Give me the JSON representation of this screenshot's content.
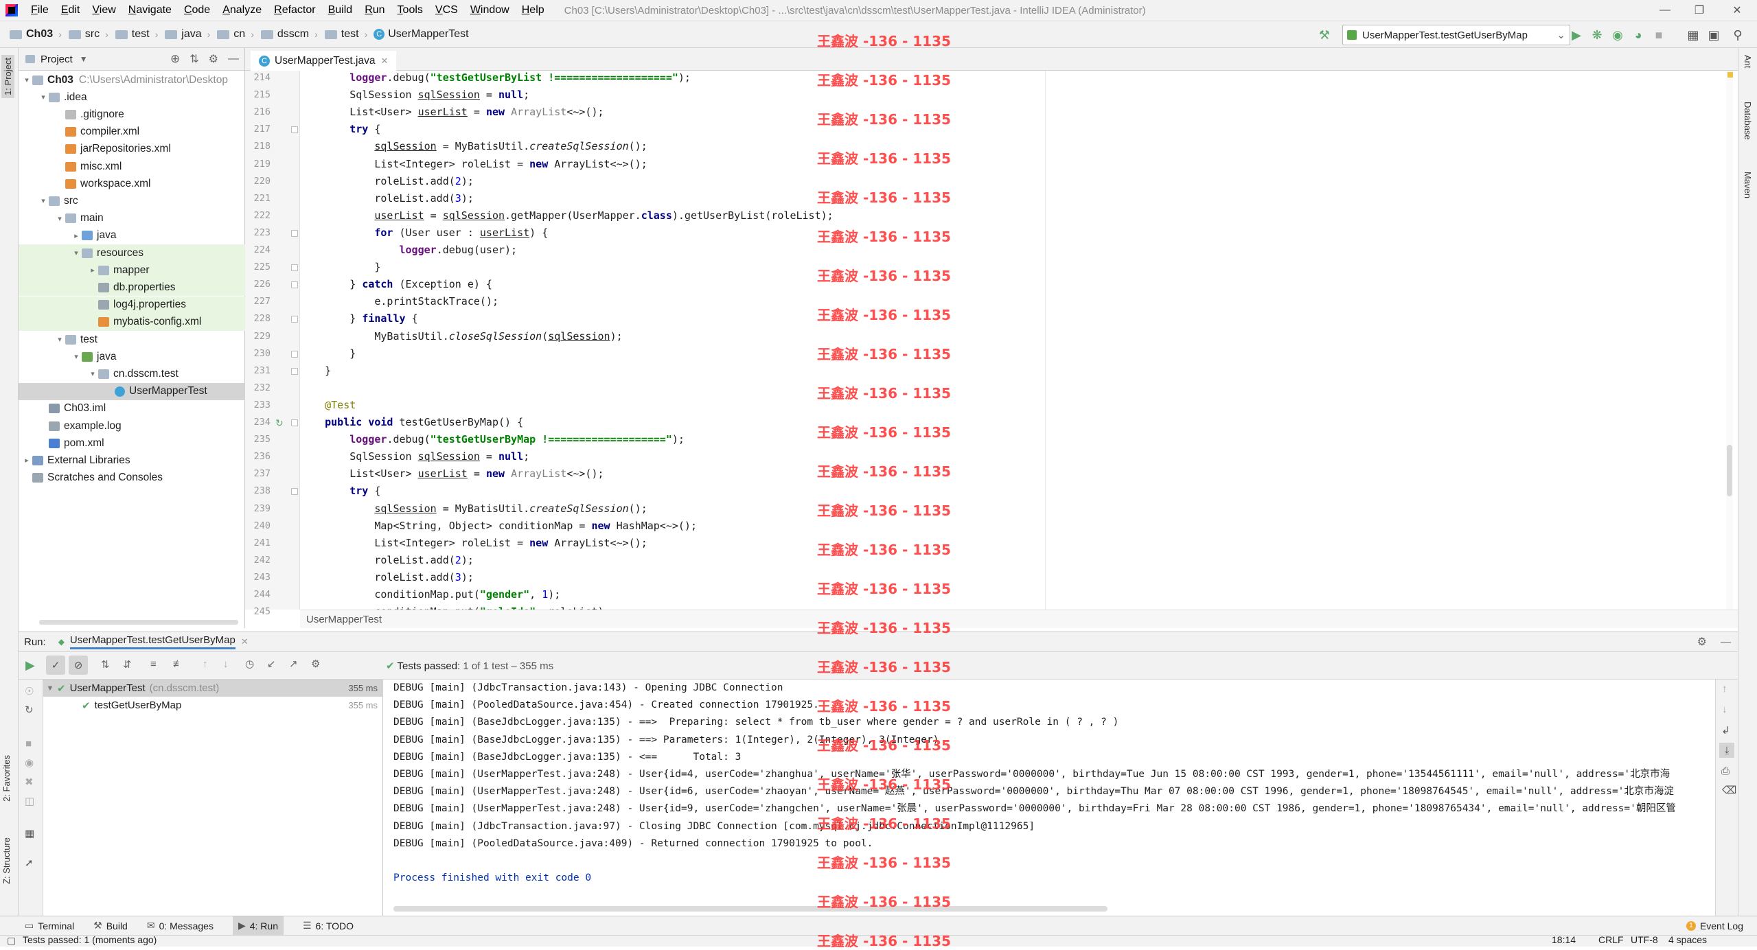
{
  "menu": [
    "File",
    "Edit",
    "View",
    "Navigate",
    "Code",
    "Analyze",
    "Refactor",
    "Build",
    "Run",
    "Tools",
    "VCS",
    "Window",
    "Help"
  ],
  "window_title": "Ch03 [C:\\Users\\Administrator\\Desktop\\Ch03] - ...\\src\\test\\java\\cn\\dsscm\\test\\UserMapperTest.java - IntelliJ IDEA (Administrator)",
  "breadcrumb": [
    "Ch03",
    "src",
    "test",
    "java",
    "cn",
    "dsscm",
    "test",
    "UserMapperTest"
  ],
  "run_config": "UserMapperTest.testGetUserByMap",
  "left_tabs": {
    "project": "1: Project",
    "favorites": "2: Favorites",
    "structure": "Z: Structure"
  },
  "right_tabs": {
    "ant": "Ant",
    "database": "Database",
    "maven": "Maven"
  },
  "project_panel": {
    "title": "Project",
    "tree": [
      {
        "label": "Ch03",
        "hint": "C:\\Users\\Administrator\\Desktop",
        "type": "module",
        "depth": 0,
        "open": true
      },
      {
        "label": ".idea",
        "type": "folder",
        "depth": 1,
        "open": true
      },
      {
        "label": ".gitignore",
        "type": "file",
        "depth": 2
      },
      {
        "label": "compiler.xml",
        "type": "xml",
        "depth": 2
      },
      {
        "label": "jarRepositories.xml",
        "type": "xml",
        "depth": 2
      },
      {
        "label": "misc.xml",
        "type": "xml",
        "depth": 2
      },
      {
        "label": "workspace.xml",
        "type": "xml",
        "depth": 2
      },
      {
        "label": "src",
        "type": "folder",
        "depth": 1,
        "open": true
      },
      {
        "label": "main",
        "type": "folder",
        "depth": 2,
        "open": true
      },
      {
        "label": "java",
        "type": "srcfolder",
        "depth": 3,
        "open": false
      },
      {
        "label": "resources",
        "type": "resfolder",
        "depth": 3,
        "open": true
      },
      {
        "label": "mapper",
        "type": "folder",
        "depth": 4,
        "open": false
      },
      {
        "label": "db.properties",
        "type": "props",
        "depth": 4
      },
      {
        "label": "log4j.properties",
        "type": "props",
        "depth": 4
      },
      {
        "label": "mybatis-config.xml",
        "type": "xml",
        "depth": 4
      },
      {
        "label": "test",
        "type": "folder",
        "depth": 2,
        "open": true
      },
      {
        "label": "java",
        "type": "testfolder",
        "depth": 3,
        "open": true
      },
      {
        "label": "cn.dsscm.test",
        "type": "package",
        "depth": 4,
        "open": true
      },
      {
        "label": "UserMapperTest",
        "type": "class",
        "depth": 5,
        "selected": true
      },
      {
        "label": "Ch03.iml",
        "type": "iml",
        "depth": 1
      },
      {
        "label": "example.log",
        "type": "log",
        "depth": 1
      },
      {
        "label": "pom.xml",
        "type": "maven",
        "depth": 1
      },
      {
        "label": "External Libraries",
        "type": "libs",
        "depth": 0,
        "open": false
      },
      {
        "label": "Scratches and Consoles",
        "type": "scratch",
        "depth": 0
      }
    ]
  },
  "editor": {
    "tab": "UserMapperTest.java",
    "footer": "UserMapperTest",
    "lines": [
      {
        "n": "214",
        "html": "        <span class=\"fld\">logger</span>.debug(<span class=\"str\">\"testGetUserByList !===================\"</span>);"
      },
      {
        "n": "215",
        "html": "        SqlSession <span class=\"ul\">sqlSession</span> = <span class=\"kw\">null</span>;"
      },
      {
        "n": "216",
        "html": "        List&lt;User&gt; <span class=\"ul\">userList</span> = <span class=\"kw\">new</span> <span class=\"grey\">ArrayList</span>&lt;~&gt;();"
      },
      {
        "n": "217",
        "html": "        <span class=\"kw\">try</span> {"
      },
      {
        "n": "218",
        "html": "            <span class=\"ul\">sqlSession</span> = MyBatisUtil.<span class=\"it\">createSqlSession</span>();"
      },
      {
        "n": "219",
        "html": "            List&lt;Integer&gt; roleList = <span class=\"kw\">new</span> ArrayList&lt;~&gt;();"
      },
      {
        "n": "220",
        "html": "            roleList.add(<span class=\"kw\" style=\"color:#0000ff;font-weight:normal\">2</span>);"
      },
      {
        "n": "221",
        "html": "            roleList.add(<span class=\"kw\" style=\"color:#0000ff;font-weight:normal\">3</span>);"
      },
      {
        "n": "222",
        "html": "            <span class=\"ul\">userList</span> = <span class=\"ul\">sqlSession</span>.getMapper(UserMapper.<span class=\"kw\">class</span>).getUserByList(roleList);"
      },
      {
        "n": "223",
        "html": "            <span class=\"kw\">for</span> (User user : <span class=\"ul\">userList</span>) {"
      },
      {
        "n": "224",
        "html": "                <span class=\"fld\">logger</span>.debug(user);"
      },
      {
        "n": "225",
        "html": "            }"
      },
      {
        "n": "226",
        "html": "        } <span class=\"kw\">catch</span> (Exception e) {"
      },
      {
        "n": "227",
        "html": "            e.printStackTrace();"
      },
      {
        "n": "228",
        "html": "        } <span class=\"kw\">finally</span> {"
      },
      {
        "n": "229",
        "html": "            MyBatisUtil.<span class=\"it\">closeSqlSession</span>(<span class=\"ul\">sqlSession</span>);"
      },
      {
        "n": "230",
        "html": "        }"
      },
      {
        "n": "231",
        "html": "    }"
      },
      {
        "n": "232",
        "html": ""
      },
      {
        "n": "233",
        "html": "    <span class=\"ann\">@Test</span>"
      },
      {
        "n": "234",
        "html": "    <span class=\"kw\">public void</span> testGetUserByMap() {"
      },
      {
        "n": "235",
        "html": "        <span class=\"fld\">logger</span>.debug(<span class=\"str\">\"testGetUserByMap !===================\"</span>);"
      },
      {
        "n": "236",
        "html": "        SqlSession <span class=\"ul\">sqlSession</span> = <span class=\"kw\">null</span>;"
      },
      {
        "n": "237",
        "html": "        List&lt;User&gt; <span class=\"ul\">userList</span> = <span class=\"kw\">new</span> <span class=\"grey\">ArrayList</span>&lt;~&gt;();"
      },
      {
        "n": "238",
        "html": "        <span class=\"kw\">try</span> {"
      },
      {
        "n": "239",
        "html": "            <span class=\"ul\">sqlSession</span> = MyBatisUtil.<span class=\"it\">createSqlSession</span>();"
      },
      {
        "n": "240",
        "html": "            Map&lt;String, Object&gt; conditionMap = <span class=\"kw\">new</span> HashMap&lt;~&gt;();"
      },
      {
        "n": "241",
        "html": "            List&lt;Integer&gt; roleList = <span class=\"kw\">new</span> ArrayList&lt;~&gt;();"
      },
      {
        "n": "242",
        "html": "            roleList.add(<span style=\"color:#0000ff\">2</span>);"
      },
      {
        "n": "243",
        "html": "            roleList.add(<span style=\"color:#0000ff\">3</span>);"
      },
      {
        "n": "244",
        "html": "            conditionMap.put(<span class=\"str\">\"gender\"</span>, <span style=\"color:#0000ff\">1</span>);"
      },
      {
        "n": "245",
        "html": "            conditionMap.put(<span class=\"str\">\"roleIds\"</span>, roleList);"
      }
    ]
  },
  "run_panel": {
    "label": "Run:",
    "tab": "UserMapperTest.testGetUserByMap",
    "tests_passed_label": "Tests passed:",
    "tests_passed_detail": "1 of 1 test – 355 ms",
    "tree": [
      {
        "name": "UserMapperTest",
        "pkg": "(cn.dsscm.test)",
        "time": "355 ms"
      },
      {
        "name": "testGetUserByMap",
        "time": "355 ms"
      }
    ],
    "console": [
      "DEBUG [main] (JdbcTransaction.java:143) - Opening JDBC Connection",
      "DEBUG [main] (PooledDataSource.java:454) - Created connection 17901925.",
      "DEBUG [main] (BaseJdbcLogger.java:135) - ==>  Preparing: select * from tb_user where gender = ? and userRole in ( ? , ? )",
      "DEBUG [main] (BaseJdbcLogger.java:135) - ==> Parameters: 1(Integer), 2(Integer), 3(Integer)",
      "DEBUG [main] (BaseJdbcLogger.java:135) - <==      Total: 3",
      "DEBUG [main] (UserMapperTest.java:248) - User{id=4, userCode='zhanghua', userName='张华', userPassword='0000000', birthday=Tue Jun 15 08:00:00 CST 1993, gender=1, phone='13544561111', email='null', address='北京市海",
      "DEBUG [main] (UserMapperTest.java:248) - User{id=6, userCode='zhaoyan', userName='赵燕', userPassword='0000000', birthday=Thu Mar 07 08:00:00 CST 1996, gender=1, phone='18098764545', email='null', address='北京市海淀",
      "DEBUG [main] (UserMapperTest.java:248) - User{id=9, userCode='zhangchen', userName='张晨', userPassword='0000000', birthday=Fri Mar 28 08:00:00 CST 1986, gender=1, phone='18098765434', email='null', address='朝阳区管",
      "DEBUG [main] (JdbcTransaction.java:97) - Closing JDBC Connection [com.mysql.cj.jdbc.ConnectionImpl@1112965]",
      "DEBUG [main] (PooledDataSource.java:409) - Returned connection 17901925 to pool.",
      "",
      "Process finished with exit code 0"
    ]
  },
  "tool_tabs": [
    "Terminal",
    "Build",
    "0: Messages",
    "4: Run",
    "6: TODO"
  ],
  "event_log": "Event Log",
  "status": {
    "left": "Tests passed: 1 (moments ago)",
    "pos": "18:14",
    "eol": "CRLF",
    "enc": "UTF-8",
    "indent": "4 spaces"
  },
  "watermark": "王鑫波 -136 - 1135",
  "colors": {
    "accent": "#4083c9",
    "pass": "#59a869",
    "run": "#59a869",
    "watermark": "#ff3b3b"
  }
}
